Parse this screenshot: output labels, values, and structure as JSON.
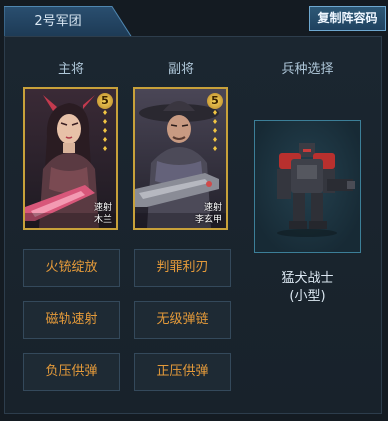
{
  "tab": {
    "label": "2号军团"
  },
  "copy_button": {
    "label": "复制阵容码"
  },
  "headers": {
    "main": "主将",
    "vice": "副将",
    "troop": "兵种选择"
  },
  "generals": [
    {
      "role": "main",
      "star_level": "5",
      "weapon_type": "速射",
      "name": "木兰"
    },
    {
      "role": "vice",
      "star_level": "5",
      "weapon_type": "速射",
      "name": "李玄甲"
    }
  ],
  "troop": {
    "name_line1": "猛犬战士",
    "name_line2": "(小型)"
  },
  "skills": [
    {
      "label": "火铳绽放"
    },
    {
      "label": "判罪利刃"
    },
    {
      "label": "磁轨速射"
    },
    {
      "label": "无级弹链"
    },
    {
      "label": "负压供弹"
    },
    {
      "label": "正压供弹"
    }
  ],
  "colors": {
    "accent_gold": "#c8a13a",
    "skill_text": "#e49a3a",
    "panel_bg": "#1b2630"
  }
}
